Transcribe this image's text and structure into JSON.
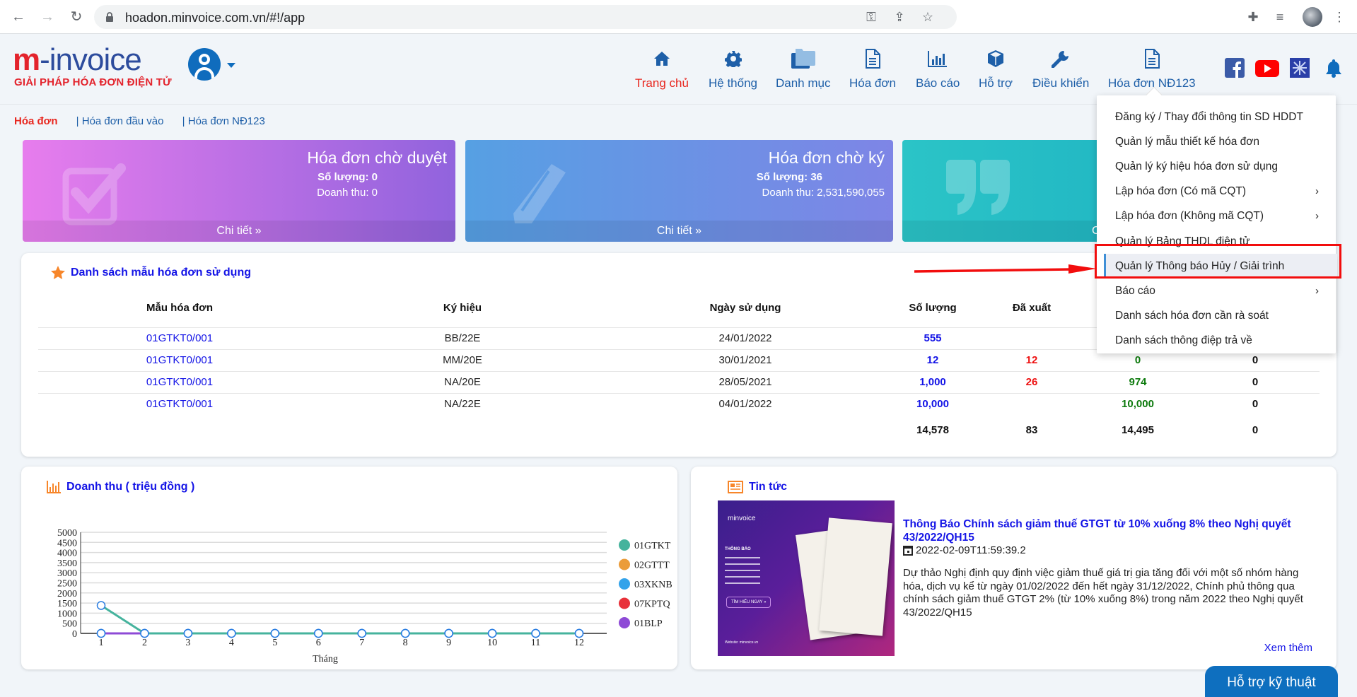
{
  "browser": {
    "url": "hoadon.minvoice.com.vn/#!/app"
  },
  "logo": {
    "brand_m": "m",
    "brand_rest": "-invoice",
    "tagline": "GIẢI PHÁP HÓA ĐƠN ĐIỆN TỬ"
  },
  "nav": {
    "items": [
      {
        "label": "Trang chủ",
        "icon": "home-icon",
        "active": true
      },
      {
        "label": "Hệ thống",
        "icon": "gear-icon"
      },
      {
        "label": "Danh mục",
        "icon": "folder-icon"
      },
      {
        "label": "Hóa đơn",
        "icon": "document-icon"
      },
      {
        "label": "Báo cáo",
        "icon": "bar-chart-icon"
      },
      {
        "label": "Hỗ trợ",
        "icon": "cube-icon"
      },
      {
        "label": "Điều khiển",
        "icon": "wrench-icon"
      },
      {
        "label": "Hóa đơn NĐ123",
        "icon": "document-icon"
      }
    ]
  },
  "social": [
    "facebook-icon",
    "youtube-icon",
    "minvoice-icon",
    "bell-icon"
  ],
  "breadcrumbs": [
    {
      "label": "Hóa đơn",
      "active": true
    },
    {
      "label": "| Hóa đơn đầu vào"
    },
    {
      "label": "| Hóa đơn NĐ123"
    }
  ],
  "stat_cards": [
    {
      "title": "Hóa đơn chờ duyệt",
      "qty": "Số lượng: 0",
      "revenue": "Doanh thu: 0",
      "footer": "Chi tiết",
      "color_from": "#e77ded",
      "color_to": "#9163dd"
    },
    {
      "title": "Hóa đơn chờ ký",
      "qty": "Số lượng: 36",
      "revenue": "Doanh thu: 2,531,590,055",
      "footer": "Chi tiết",
      "color_from": "#56a0e3",
      "color_to": "#7e85e6"
    },
    {
      "title": "",
      "qty": "",
      "revenue": "",
      "footer": "C",
      "color_from": "#2bc4c7",
      "color_to": "#22b8c4"
    }
  ],
  "templates": {
    "title": "Danh sách mẫu hóa đơn sử dụng",
    "columns": [
      "Mẫu hóa đơn",
      "Ký hiệu",
      "Ngày sử dụng",
      "Số lượng",
      "Đã xuất",
      "",
      ""
    ],
    "rows": [
      {
        "mau": "01GTKT0/001",
        "ky_hieu": "BB/22E",
        "ngay": "24/01/2022",
        "so_luong": "555",
        "da_xuat": "",
        "con_lai": "",
        "huy": ""
      },
      {
        "mau": "01GTKT0/001",
        "ky_hieu": "MM/20E",
        "ngay": "30/01/2021",
        "so_luong": "12",
        "da_xuat": "12",
        "con_lai": "0",
        "huy": "0"
      },
      {
        "mau": "01GTKT0/001",
        "ky_hieu": "NA/20E",
        "ngay": "28/05/2021",
        "so_luong": "1,000",
        "da_xuat": "26",
        "con_lai": "974",
        "huy": "0"
      },
      {
        "mau": "01GTKT0/001",
        "ky_hieu": "NA/22E",
        "ngay": "04/01/2022",
        "so_luong": "10,000",
        "da_xuat": "",
        "con_lai": "10,000",
        "huy": "0"
      }
    ],
    "totals": {
      "so_luong": "14,578",
      "da_xuat": "83",
      "con_lai": "14,495",
      "huy": "0"
    }
  },
  "chart_panel": {
    "title": "Doanh thu ( triệu đồng )"
  },
  "chart_data": {
    "type": "line",
    "title": "Doanh thu ( triệu đồng )",
    "xlabel": "Tháng",
    "ylabel": "",
    "x": [
      1,
      2,
      3,
      4,
      5,
      6,
      7,
      8,
      9,
      10,
      11,
      12
    ],
    "ylim": [
      0,
      5000
    ],
    "yticks": [
      0,
      500,
      1000,
      1500,
      2000,
      2500,
      3000,
      3500,
      4000,
      4500,
      5000
    ],
    "grid": true,
    "legend": "right",
    "series": [
      {
        "name": "01GTKT",
        "color": "#45b39d",
        "values": [
          1380,
          0,
          0,
          0,
          0,
          0,
          0,
          0,
          0,
          0,
          0,
          0
        ]
      },
      {
        "name": "02GTTT",
        "color": "#eb9c3a",
        "values": [
          0,
          0,
          0,
          0,
          0,
          0,
          0,
          0,
          0,
          0,
          0,
          0
        ]
      },
      {
        "name": "03XKNB",
        "color": "#34a3ea",
        "values": [
          0,
          0,
          0,
          0,
          0,
          0,
          0,
          0,
          0,
          0,
          0,
          0
        ]
      },
      {
        "name": "07KPTQ",
        "color": "#e8313a",
        "values": [
          0,
          0,
          0,
          0,
          0,
          0,
          0,
          0,
          0,
          0,
          0,
          0
        ]
      },
      {
        "name": "01BLP",
        "color": "#8e4ad6",
        "values": [
          0,
          0,
          0,
          0,
          0,
          0,
          0,
          0,
          0,
          0,
          0,
          0
        ]
      }
    ]
  },
  "news": {
    "title": "Tin tức",
    "headline": "Thông Báo Chính sách giảm thuế GTGT từ 10% xuống 8% theo Nghị quyết 43/2022/QH15",
    "date": "2022-02-09T11:59:39.2",
    "body": "Dự thảo Nghị định quy định việc giảm thuế giá trị gia tăng đối với một số nhóm hàng hóa, dịch vụ kể từ ngày 01/02/2022 đến hết ngày 31/12/2022, Chính phủ thông qua chính sách giảm thuế GTGT 2% (từ 10% xuống 8%) trong năm 2022 theo Nghị quyết 43/2022/QH15",
    "more": "Xem thêm",
    "image_texts": {
      "brand": "minvoice",
      "label": "THÔNG BÁO",
      "cta": "TÌM HIỂU NGAY »",
      "website": "Website: minvoice.vn"
    }
  },
  "support_button": "Hỗ trợ kỹ thuật",
  "dropdown": {
    "items": [
      {
        "label": "Đăng ký / Thay đổi thông tin SD HDDT"
      },
      {
        "label": "Quản lý mẫu thiết kế hóa đơn"
      },
      {
        "label": "Quản lý ký hiệu hóa đơn sử dụng"
      },
      {
        "label": "Lập hóa đơn (Có mã CQT)",
        "submenu": true
      },
      {
        "label": "Lập hóa đơn (Không mã CQT)",
        "submenu": true
      },
      {
        "label": "Quản lý Bảng THDL điện tử"
      },
      {
        "label": "Quản lý Thông báo Hủy / Giải trình",
        "highlighted": true
      },
      {
        "label": "Báo cáo",
        "submenu": true
      },
      {
        "label": "Danh sách hóa đơn cần rà soát"
      },
      {
        "label": "Danh sách thông điệp trả về"
      }
    ],
    "submenu_glyph": "›"
  }
}
